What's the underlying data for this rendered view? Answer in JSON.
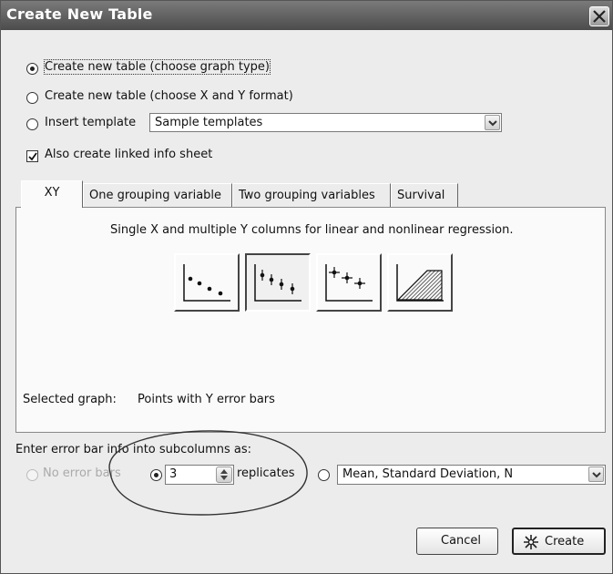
{
  "window": {
    "title": "Create New Table"
  },
  "options": {
    "choose_graph_type": "Create new table (choose graph type)",
    "choose_xy_format": "Create new table (choose X and Y format)",
    "insert_template": "Insert template",
    "template_select_value": "Sample templates",
    "linked_info_sheet": "Also create linked info sheet",
    "selected_option": "choose_graph_type",
    "linked_info_checked": true
  },
  "tabs": [
    {
      "label": "XY",
      "active": true
    },
    {
      "label": "One grouping variable",
      "active": false
    },
    {
      "label": "Two grouping variables",
      "active": false
    },
    {
      "label": "Survival",
      "active": false
    }
  ],
  "panel": {
    "description": "Single X and multiple Y columns for linear and nonlinear regression.",
    "graph_types": [
      {
        "icon": "points-only-graph-icon"
      },
      {
        "icon": "points-with-y-error-bars-graph-icon",
        "selected": true
      },
      {
        "icon": "points-with-xy-error-bars-graph-icon"
      },
      {
        "icon": "area-fill-graph-icon"
      }
    ],
    "selected_graph_label": "Selected graph:",
    "selected_graph_value": "Points with Y error bars"
  },
  "error_bars": {
    "heading": "Enter error bar info into subcolumns as:",
    "no_error_bars": "No error bars",
    "replicates_value": "3",
    "replicates_label": "replicates",
    "format_select_value": "Mean, Standard Deviation, N",
    "selected": "replicates"
  },
  "buttons": {
    "cancel": "Cancel",
    "create": "Create"
  },
  "colors": {
    "titlebar": "#5e5e5e",
    "panel": "#fafafa",
    "dialog": "#ececec"
  }
}
